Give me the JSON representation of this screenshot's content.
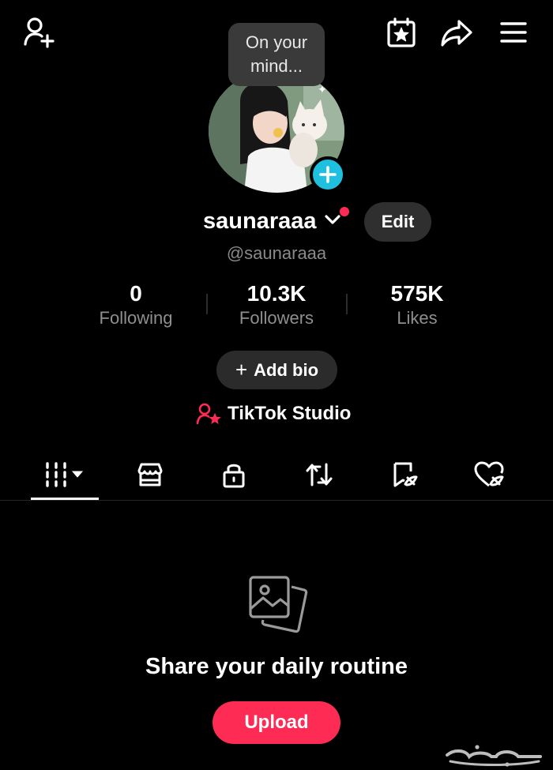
{
  "header": {
    "add_friend_icon": "person-plus-icon",
    "calendar_icon": "calendar-star-icon",
    "share_icon": "share-arrow-icon",
    "menu_icon": "hamburger-menu-icon"
  },
  "note_bubble": {
    "text": "On your mind..."
  },
  "profile": {
    "display_name": "saunaraaa",
    "handle": "@saunaraaa",
    "edit_label": "Edit",
    "notification_dot_color": "#fe2c55",
    "avatar_add_color": "#1fbfe0"
  },
  "stats": [
    {
      "value": "0",
      "label": "Following"
    },
    {
      "value": "10.3K",
      "label": "Followers"
    },
    {
      "value": "575K",
      "label": "Likes"
    }
  ],
  "add_bio": {
    "icon": "+",
    "label": "Add bio"
  },
  "studio": {
    "label": "TikTok Studio",
    "icon": "studio-person-star-icon"
  },
  "tabs": [
    {
      "icon": "grid-videos-icon",
      "selected": true
    },
    {
      "icon": "shop-icon",
      "selected": false
    },
    {
      "icon": "lock-icon",
      "selected": false
    },
    {
      "icon": "repost-icon",
      "selected": false
    },
    {
      "icon": "favorites-bookmark-icon",
      "selected": false
    },
    {
      "icon": "liked-heart-icon",
      "selected": false
    }
  ],
  "empty_state": {
    "icon": "photos-stack-icon",
    "title": "Share your daily routine",
    "upload_label": "Upload"
  },
  "watermark": {
    "text": "حراج"
  },
  "colors": {
    "accent": "#fe2c55",
    "background": "#000000",
    "muted": "#8f8f8f"
  }
}
